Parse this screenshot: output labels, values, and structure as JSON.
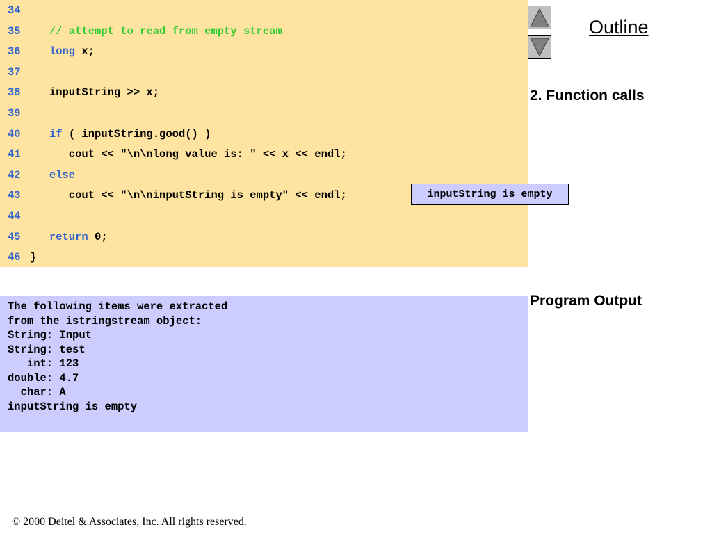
{
  "nav": {
    "outline_label": "Outline",
    "up_icon": "up-triangle-icon",
    "down_icon": "down-triangle-icon"
  },
  "side_labels": {
    "function_calls": "2. Function calls",
    "program_output": "Program Output"
  },
  "code": {
    "lines": [
      {
        "num": "34",
        "segments": []
      },
      {
        "num": "35",
        "segments": [
          {
            "t": "   ",
            "c": ""
          },
          {
            "t": "// attempt to read from empty stream",
            "c": "cm"
          }
        ]
      },
      {
        "num": "36",
        "segments": [
          {
            "t": "   ",
            "c": ""
          },
          {
            "t": "long",
            "c": "kw"
          },
          {
            "t": " x;",
            "c": ""
          }
        ]
      },
      {
        "num": "37",
        "segments": []
      },
      {
        "num": "38",
        "segments": [
          {
            "t": "   inputString >> x;",
            "c": ""
          }
        ]
      },
      {
        "num": "39",
        "segments": []
      },
      {
        "num": "40",
        "segments": [
          {
            "t": "   ",
            "c": ""
          },
          {
            "t": "if",
            "c": "kw"
          },
          {
            "t": " ( inputString.good() )",
            "c": ""
          }
        ]
      },
      {
        "num": "41",
        "segments": [
          {
            "t": "      cout << \"\\n\\nlong value is: \" << x << endl;",
            "c": ""
          }
        ]
      },
      {
        "num": "42",
        "segments": [
          {
            "t": "   ",
            "c": ""
          },
          {
            "t": "else",
            "c": "kw"
          }
        ]
      },
      {
        "num": "43",
        "segments": [
          {
            "t": "      cout << \"\\n\\ninputString is empty\" << endl;",
            "c": ""
          }
        ]
      },
      {
        "num": "44",
        "segments": []
      },
      {
        "num": "45",
        "segments": [
          {
            "t": "   ",
            "c": ""
          },
          {
            "t": "return",
            "c": "kw"
          },
          {
            "t": " 0;",
            "c": ""
          }
        ]
      },
      {
        "num": "46",
        "segments": [
          {
            "t": "}",
            "c": ""
          }
        ]
      }
    ]
  },
  "callout": {
    "text": "inputString is empty"
  },
  "output": {
    "lines": [
      "The following items were extracted",
      "from the istringstream object:",
      "String: Input",
      "String: test",
      "   int: 123",
      "double: 4.7",
      "  char: A",
      "inputString is empty"
    ]
  },
  "footer": {
    "text": "© 2000 Deitel & Associates, Inc.  All rights reserved."
  },
  "colors": {
    "code_bg": "#ffe3a0",
    "output_bg": "#ccccff",
    "keyword": "#3366cc",
    "comment": "#33cc33",
    "line_number": "#3366cc"
  }
}
